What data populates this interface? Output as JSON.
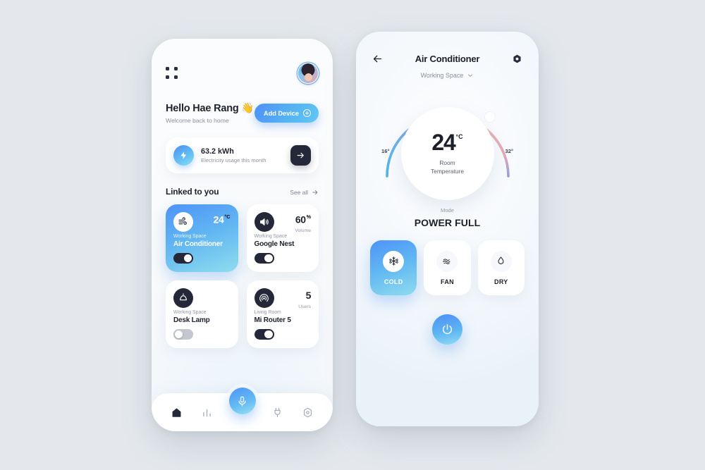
{
  "background_color": "#e4e8ec",
  "accent_color": "#4f93f7",
  "dark_color": "#252839",
  "home_screen": {
    "menu_icon": "grid-menu-icon",
    "avatar": "user-avatar",
    "greeting": "Hello Hae Rang 👋",
    "greeting_sub": "Welcome back to home",
    "add_device_label": "Add Device",
    "energy": {
      "icon": "bolt-icon",
      "value": "63.2 kWh",
      "label": "Electricity usage this month",
      "arrow": "→"
    },
    "section_title": "Linked to you",
    "see_all_label": "See all",
    "devices": [
      {
        "icon": "air-flow-icon",
        "metric": "24",
        "unit": "°C",
        "metric_sub": "",
        "room": "Working Space",
        "name": "Air Conditioner",
        "toggle": "on",
        "active": true
      },
      {
        "icon": "speaker-icon",
        "metric": "60",
        "unit": "%",
        "metric_sub": "Volume",
        "room": "Working Space",
        "name": "Google Nest",
        "toggle": "on",
        "active": false
      },
      {
        "icon": "lamp-icon",
        "metric": "",
        "unit": "",
        "metric_sub": "",
        "room": "Working Space",
        "name": "Desk Lamp",
        "toggle": "off",
        "active": false
      },
      {
        "icon": "wifi-router-icon",
        "metric": "5",
        "unit": "",
        "metric_sub": "Users",
        "room": "Living Room",
        "name": "Mi Router 5",
        "toggle": "on",
        "active": false
      }
    ],
    "nav": [
      {
        "icon": "home-icon",
        "active": true
      },
      {
        "icon": "bar-chart-icon",
        "active": false
      },
      {
        "icon": "microphone-icon",
        "active": false
      },
      {
        "icon": "plug-icon",
        "active": false
      },
      {
        "icon": "settings-hex-icon",
        "active": false
      }
    ]
  },
  "ac_screen": {
    "back_icon": "back-arrow-icon",
    "title": "Air Conditioner",
    "settings_icon": "settings-hex-icon",
    "room": "Working Space",
    "dial": {
      "temperature": "24",
      "unit": "°C",
      "label_line1": "Room",
      "label_line2": "Temperature",
      "min_tick": "16°",
      "max_tick": "32°",
      "min_value": 16,
      "max_value": 32,
      "current_value": 24,
      "arc_start_color": "#5bb6ea",
      "arc_mid_color": "#9db6e0",
      "arc_end_color": "#f3a9a4"
    },
    "mode_label": "Mode",
    "mode_value": "POWER FULL",
    "modes": [
      {
        "icon": "snowflake-icon",
        "name": "COLD",
        "active": true
      },
      {
        "icon": "fan-waves-icon",
        "name": "FAN",
        "active": false
      },
      {
        "icon": "water-drop-icon",
        "name": "DRY",
        "active": false
      }
    ],
    "power_icon": "power-icon"
  }
}
